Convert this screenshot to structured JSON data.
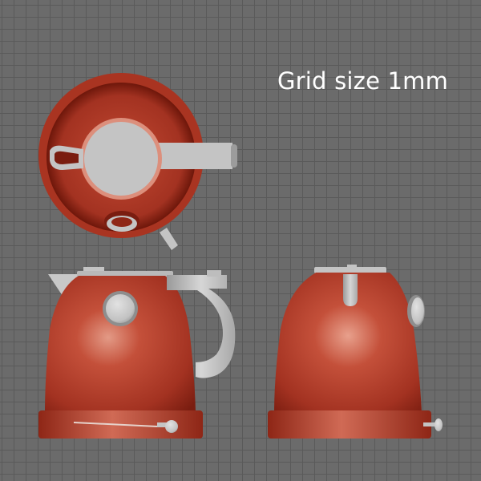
{
  "viewport": {
    "label": "Grid size 1mm",
    "colors": {
      "background": "#6b6b6b",
      "grid_line": "#5a5a5a",
      "label": "#ffffff",
      "kettle_body": "#b43a26",
      "kettle_shadow": "#7a1d10",
      "kettle_highlight": "#e9a38f",
      "metal": "#c8c8c8",
      "metal_shadow": "#8c8c8c"
    },
    "views": [
      {
        "name": "top-view"
      },
      {
        "name": "front-view"
      },
      {
        "name": "side-view"
      }
    ]
  }
}
